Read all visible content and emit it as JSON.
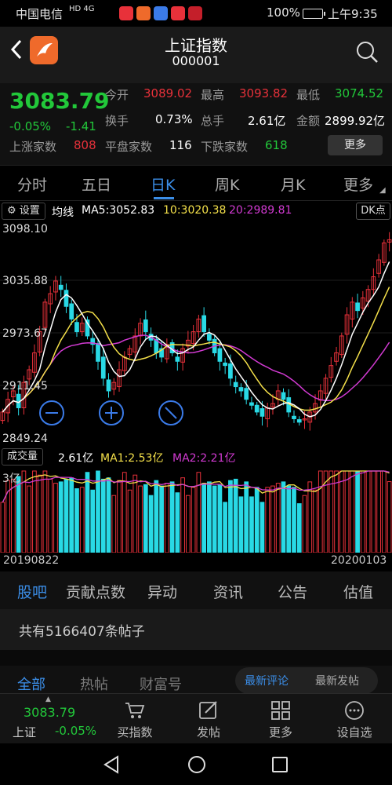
{
  "statusbar": {
    "carrier": "中国电信",
    "network": "HD 4G",
    "battery": "100%",
    "time": "上午9:35"
  },
  "header": {
    "title": "上证指数",
    "code": "000001"
  },
  "quote": {
    "price": "3083.79",
    "pct_change": "-0.05%",
    "change": "-1.41",
    "open_label": "今开",
    "open_value": "3089.02",
    "high_label": "最高",
    "high_value": "3093.82",
    "low_label": "最低",
    "low_value": "3074.52",
    "turnover_label": "换手",
    "turnover_value": "0.73%",
    "hands_label": "总手",
    "hands_value": "2.61亿",
    "amount_label": "金额",
    "amount_value": "2899.92亿",
    "up_label": "上涨家数",
    "up_value": "808",
    "flat_label": "平盘家数",
    "flat_value": "116",
    "down_label": "下跌家数",
    "down_value": "618",
    "more_button": "更多"
  },
  "chart_tabs": [
    "分时",
    "五日",
    "日K",
    "周K",
    "月K",
    "更多"
  ],
  "chart_tab_active": "日K",
  "ma_bar": {
    "settings_label": "设置",
    "avg_label": "均线",
    "ma5": "MA5:3052.83",
    "ma10": "10:3020.38",
    "ma20": "20:2989.81",
    "dk_label": "DK点"
  },
  "price_axis": [
    "3098.10",
    "3035.88",
    "2973.67",
    "2911.45",
    "2849.24"
  ],
  "volume_bar": {
    "label": "成交量",
    "value": "2.61亿",
    "ma1": "MA1:2.53亿",
    "ma2": "MA2:2.21亿"
  },
  "volume_axis_top": "3亿",
  "dates": {
    "start": "20190822",
    "end": "20200103"
  },
  "sub_tabs": [
    "股吧",
    "贡献点数",
    "异动",
    "资讯",
    "公告",
    "估值"
  ],
  "posts_count_text": "共有5166407条帖子",
  "forum_tabs": [
    "全部",
    "热帖",
    "财富号"
  ],
  "sort_buttons": [
    "最新评论",
    "最新发帖"
  ],
  "bottom_bar": {
    "mini_price": "3083.79",
    "mini_name": "上证",
    "mini_pct": "-0.05%",
    "items": [
      "买指数",
      "发帖",
      "更多",
      "设自选"
    ]
  },
  "colors": {
    "up": "#e8313a",
    "down": "#22c83a",
    "candle_down": "#29d9e5",
    "accent": "#3b8ee8",
    "ma5": "#ffffff",
    "ma10": "#f4e04a",
    "ma20": "#d23ad2"
  },
  "chart_data": {
    "type": "candlestick",
    "x_start": "20190822",
    "x_end": "20200103",
    "ylim": [
      2849.24,
      3098.1
    ],
    "y_ticks": [
      3098.1,
      3035.88,
      2973.67,
      2911.45,
      2849.24
    ],
    "close_series": [
      2880,
      2895,
      2905,
      2885,
      2915,
      2930,
      2950,
      2975,
      3010,
      3020,
      3035,
      3025,
      3005,
      2990,
      2975,
      2985,
      2970,
      2960,
      2940,
      2920,
      2905,
      2915,
      2930,
      2945,
      2955,
      2970,
      2985,
      2975,
      2965,
      2950,
      2945,
      2960,
      2950,
      2940,
      2955,
      2965,
      2975,
      2990,
      2975,
      2965,
      2950,
      2940,
      2935,
      2920,
      2910,
      2905,
      2895,
      2888,
      2880,
      2875,
      2885,
      2890,
      2905,
      2895,
      2880,
      2872,
      2868,
      2872,
      2880,
      2890,
      2905,
      2920,
      2935,
      2950,
      2970,
      2995,
      3010,
      3000,
      3015,
      3025,
      3040,
      3060,
      3080,
      3083.79
    ],
    "series": [
      {
        "name": "MA5",
        "last": 3052.83
      },
      {
        "name": "MA10",
        "last": 3020.38
      },
      {
        "name": "MA20",
        "last": 2989.81
      }
    ],
    "volume_unit": "亿",
    "volume_max": 3.0,
    "volume_last": 2.61,
    "volume_ma1": 2.53,
    "volume_ma2": 2.21
  }
}
